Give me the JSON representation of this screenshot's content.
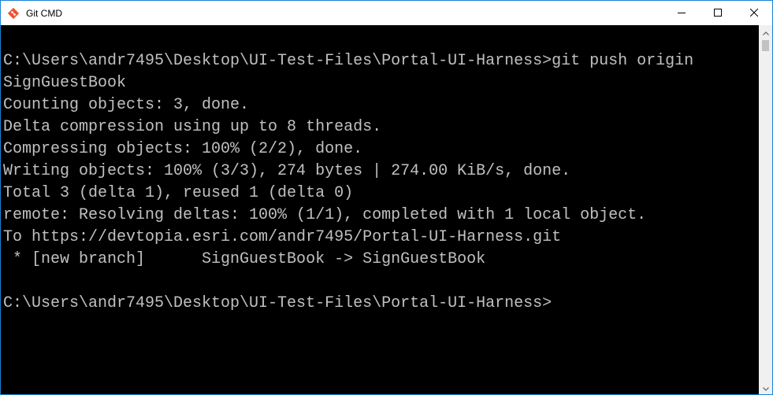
{
  "window": {
    "title": "Git CMD"
  },
  "console": {
    "lines": [
      "C:\\Users\\andr7495\\Desktop\\UI-Test-Files\\Portal-UI-Harness>git push origin",
      "SignGuestBook",
      "Counting objects: 3, done.",
      "Delta compression using up to 8 threads.",
      "Compressing objects: 100% (2/2), done.",
      "Writing objects: 100% (3/3), 274 bytes | 274.00 KiB/s, done.",
      "Total 3 (delta 1), reused 1 (delta 0)",
      "remote: Resolving deltas: 100% (1/1), completed with 1 local object.",
      "To https://devtopia.esri.com/andr7495/Portal-UI-Harness.git",
      " * [new branch]      SignGuestBook -> SignGuestBook",
      "",
      "C:\\Users\\andr7495\\Desktop\\UI-Test-Files\\Portal-UI-Harness>"
    ]
  },
  "icons": {
    "app": "git-diamond-icon",
    "minimize": "minimize-icon",
    "maximize": "maximize-icon",
    "close": "close-icon",
    "scroll_up": "chevron-up-icon",
    "scroll_down": "chevron-down-icon"
  },
  "colors": {
    "brand": "#f05133",
    "console_bg": "#000000",
    "console_text": "#c0c0c0",
    "border": "#1883d7"
  }
}
